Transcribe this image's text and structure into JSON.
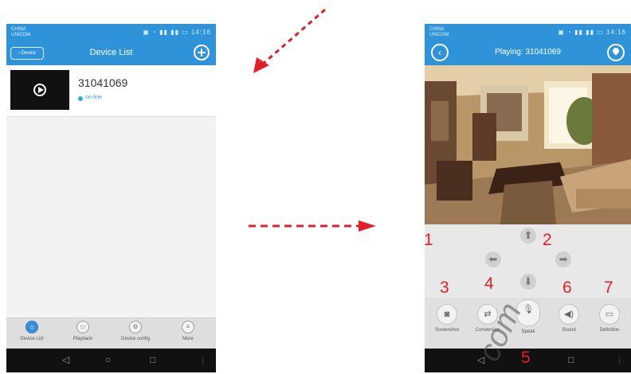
{
  "left_screen": {
    "status": {
      "carrier": "CHINA UNICOM",
      "time": "14:16"
    },
    "header": {
      "back_label": "Device",
      "title": "Device List"
    },
    "device": {
      "name": "31041069",
      "status": "on-line"
    },
    "tabs": [
      {
        "label": "Device List",
        "icon": "home-icon",
        "active": true
      },
      {
        "label": "Playback",
        "icon": "playback-icon"
      },
      {
        "label": "Device config",
        "icon": "gear-icon"
      },
      {
        "label": "More",
        "icon": "menu-icon"
      }
    ]
  },
  "right_screen": {
    "status": {
      "carrier": "CHINA UNICOM",
      "time": "14:16"
    },
    "header": {
      "title": "Playing: 31041069"
    },
    "controls": [
      {
        "label": "Screenshot",
        "icon": "camera-icon"
      },
      {
        "label": "Conversion",
        "icon": "conversion-icon"
      },
      {
        "label": "Speak",
        "icon": "microphone-icon"
      },
      {
        "label": "Sound",
        "icon": "speaker-icon"
      },
      {
        "label": "Definition",
        "icon": "monitor-icon"
      }
    ]
  },
  "annotations": [
    "1",
    "2",
    "3",
    "4",
    "5",
    "6",
    "7"
  ],
  "watermark": "com",
  "colors": {
    "accent_blue": "#2f93d9",
    "annotation_red": "#e0202a"
  }
}
